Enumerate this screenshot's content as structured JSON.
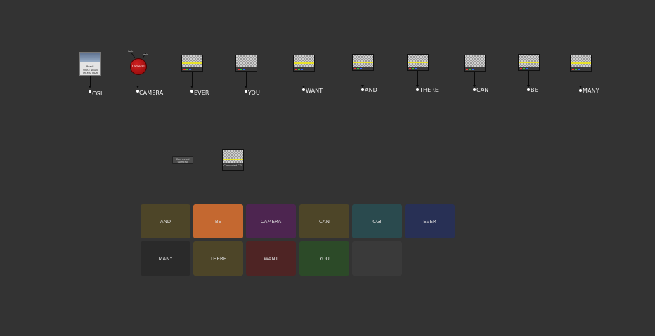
{
  "graph": {
    "read_node": {
      "title": "Read1",
      "caption": "OCIO: sRGB  IRCMS: HDR"
    },
    "camera_node": {
      "title": "Camera1",
      "inputs": [
        "look",
        "axis"
      ]
    },
    "labels": [
      "CGI",
      "CAMERA",
      "EVER",
      "YOU",
      "WANT",
      "AND",
      "THERE",
      "CAN",
      "BE",
      "MANY"
    ],
    "connect_nodes": [
      "Connected CAMERA",
      "Connected CGI"
    ]
  },
  "tiles": [
    {
      "label": "AND",
      "color": "#4d4528"
    },
    {
      "label": "BE",
      "color": "#c46830"
    },
    {
      "label": "CAMERA",
      "color": "#4d2550"
    },
    {
      "label": "CAN",
      "color": "#4d4528"
    },
    {
      "label": "CGI",
      "color": "#2a4a4e"
    },
    {
      "label": "EVER",
      "color": "#283055"
    },
    {
      "label": "MANY",
      "color": "#2a2a2a"
    },
    {
      "label": "THERE",
      "color": "#4d4528"
    },
    {
      "label": "WANT",
      "color": "#4e2424"
    },
    {
      "label": "YOU",
      "color": "#2c4a28"
    },
    {
      "label": "",
      "color": "#3a3a3a"
    }
  ]
}
